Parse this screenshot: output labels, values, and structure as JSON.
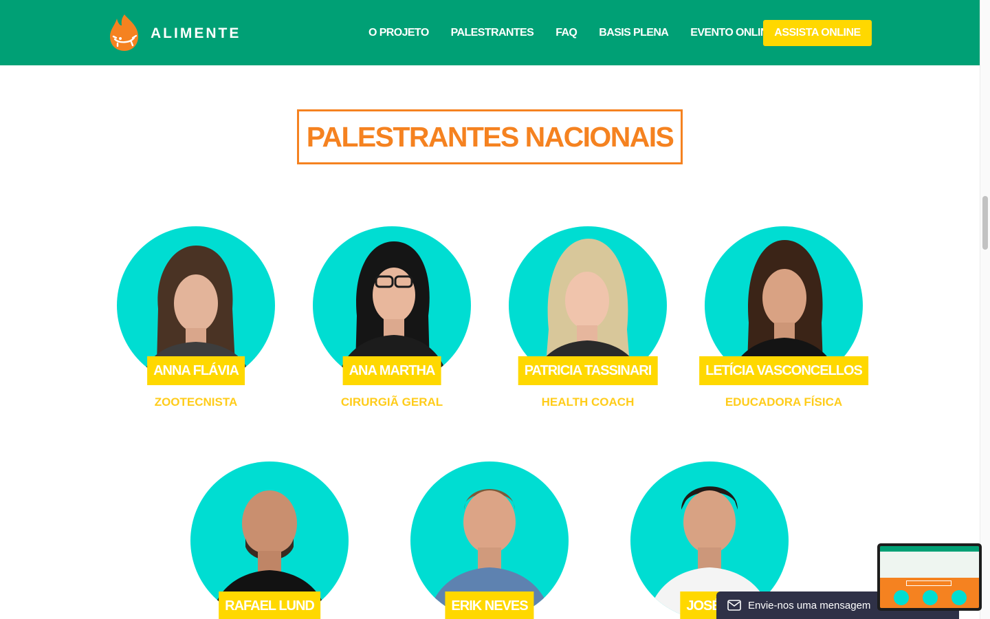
{
  "brand": {
    "name": "ALIMENTE"
  },
  "nav": {
    "items": [
      "O PROJETO",
      "PALESTRANTES",
      "FAQ",
      "BASIS PLENA",
      "EVENTO ONLINE"
    ],
    "cta": "ASSISTA ONLINE"
  },
  "section": {
    "title": "PALESTRANTES NACIONAIS"
  },
  "speakers": [
    {
      "name": "ANNA FLÁVIA",
      "role": "ZOOTECNISTA"
    },
    {
      "name": "ANA MARTHA",
      "role": "CIRURGIÃ GERAL"
    },
    {
      "name": "PATRICIA TASSINARI",
      "role": "HEALTH COACH"
    },
    {
      "name": "LETÍCIA VASCONCELLOS",
      "role": "EDUCADORA FÍSICA"
    },
    {
      "name": "RAFAEL LUND",
      "role": ""
    },
    {
      "name": "ERIK NEVES",
      "role": ""
    },
    {
      "name": "JOSÉ N",
      "role": ""
    }
  ],
  "chat": {
    "label": "Envie-nos uma mensagem"
  },
  "colors": {
    "header": "#00a075",
    "accent_orange": "#f58220",
    "accent_yellow": "#ffd800",
    "photo_bg": "#00ddd2",
    "chat_bg": "#2f3147"
  }
}
